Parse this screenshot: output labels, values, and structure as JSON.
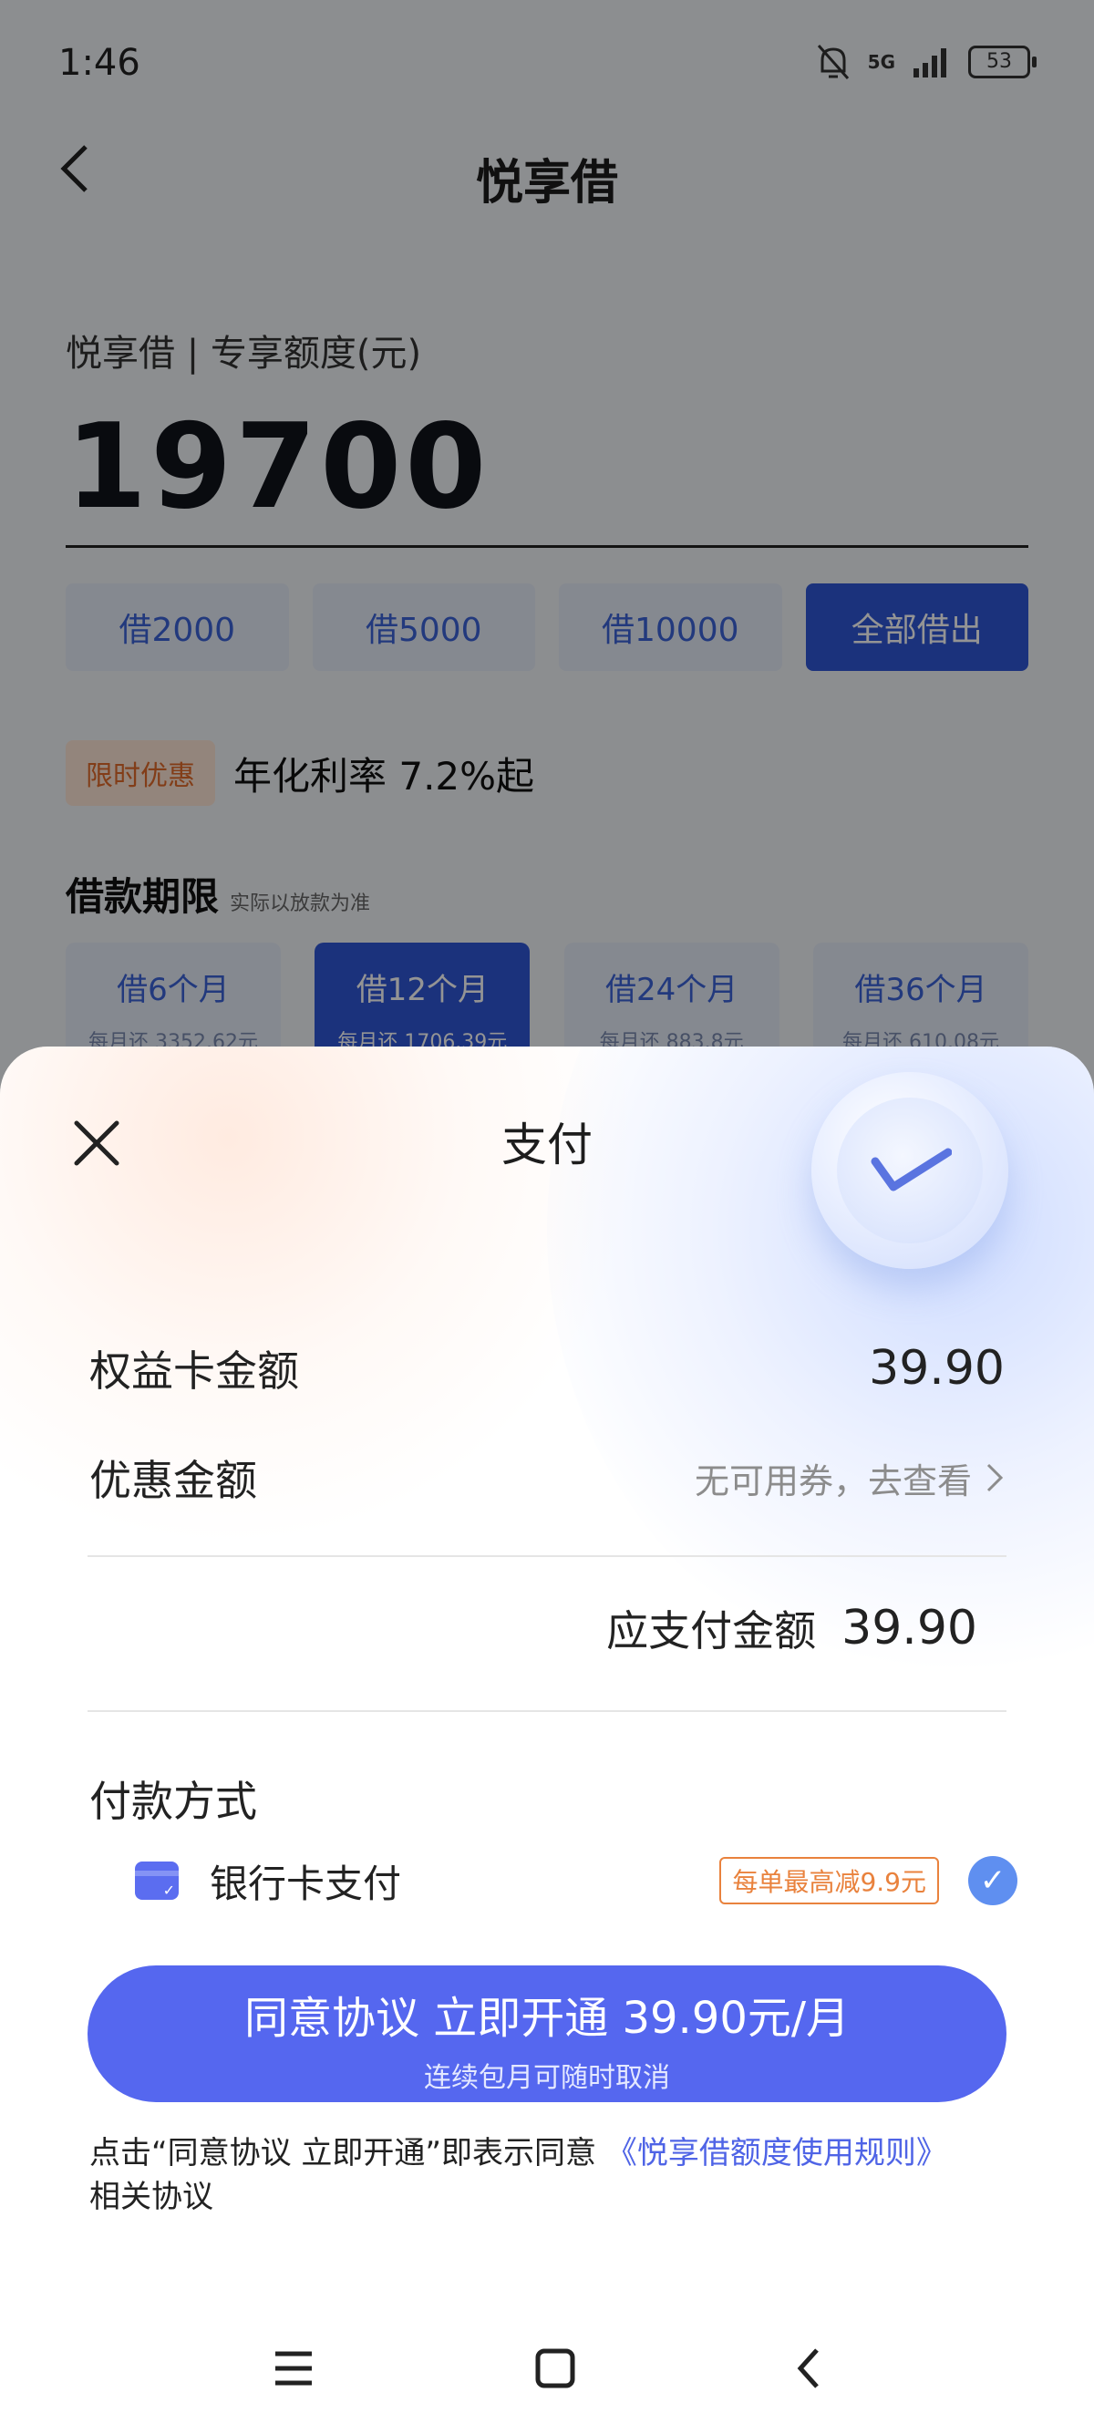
{
  "status_bar": {
    "time": "1:46",
    "network": "5G",
    "battery": "53"
  },
  "header": {
    "title": "悦享借"
  },
  "quota": {
    "label": "悦享借 | 专享额度(元)",
    "amount": "19700",
    "chips": [
      "借2000",
      "借5000",
      "借10000",
      "全部借出"
    ]
  },
  "promo": {
    "tag": "限时优惠",
    "text": "年化利率 7.2%起"
  },
  "term": {
    "title": "借款期限",
    "note": "实际以放款为准",
    "options": [
      {
        "label": "借6个月",
        "monthly": "每月还 3352.62元"
      },
      {
        "label": "借12个月",
        "monthly": "每月还 1706.39元"
      },
      {
        "label": "借24个月",
        "monthly": "每月还 883.8元"
      },
      {
        "label": "借36个月",
        "monthly": "每月还 610.08元"
      }
    ]
  },
  "sheet": {
    "title": "支付",
    "card_amount_label": "权益卡金额",
    "card_amount_value": "39.90",
    "discount_label": "优惠金额",
    "discount_value": "无可用券，去查看",
    "due_label": "应支付金额",
    "due_value": "39.90",
    "payment_title": "付款方式",
    "payment_method": "银行卡支付",
    "payment_tag": "每单最高减9.9元",
    "cta_main": "同意协议 立即开通 39.90元/月",
    "cta_sub": "连续包月可随时取消",
    "agree_prefix": "点击“同意协议 立即开通”即表示同意",
    "agree_link": "《悦享借额度使用规则》",
    "agree_suffix": "相关协议"
  },
  "colors": {
    "primary": "#2f57d6",
    "cta": "#5567ef",
    "accent_orange": "#e9823d"
  },
  "icons": [
    "bell-muted-icon",
    "signal-icon",
    "battery-icon",
    "back-icon",
    "close-icon",
    "check-badge-icon",
    "bank-card-icon",
    "checkmark-icon",
    "chevron-right-icon",
    "menu-icon",
    "home-icon",
    "nav-back-icon"
  ]
}
